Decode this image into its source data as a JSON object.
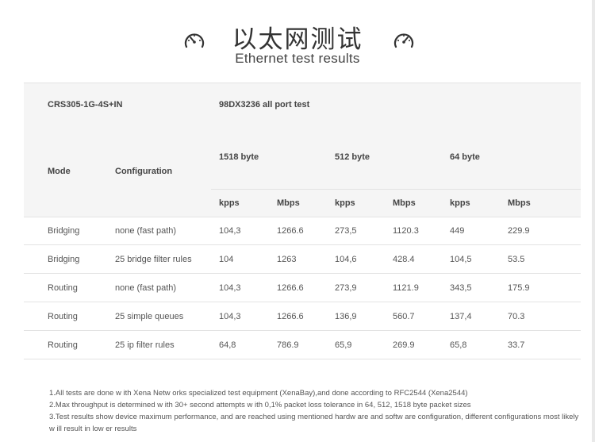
{
  "header": {
    "title_cn": "以太网测试",
    "title_en": "Ethernet test results",
    "left_icon": "speedometer-icon",
    "right_icon": "speedometer-icon"
  },
  "table": {
    "device": "CRS305-1G-4S+IN",
    "test_name": "98DX3236 all port test",
    "col_mode": "Mode",
    "col_config": "Configuration",
    "sizes": [
      "1518 byte",
      "512 byte",
      "64 byte"
    ],
    "unit_kpps": "kpps",
    "unit_mbps": "Mbps",
    "rows": [
      {
        "mode": "Bridging",
        "config": "none (fast path)",
        "v": [
          "104,3",
          "1266.6",
          "273,5",
          "1120.3",
          "449",
          "229.9"
        ]
      },
      {
        "mode": "Bridging",
        "config": "25 bridge filter rules",
        "v": [
          "104",
          "1263",
          "104,6",
          "428.4",
          "104,5",
          "53.5"
        ]
      },
      {
        "mode": "Routing",
        "config": "none (fast path)",
        "v": [
          "104,3",
          "1266.6",
          "273,9",
          "1121.9",
          "343,5",
          "175.9"
        ]
      },
      {
        "mode": "Routing",
        "config": "25 simple queues",
        "v": [
          "104,3",
          "1266.6",
          "136,9",
          "560.7",
          "137,4",
          "70.3"
        ]
      },
      {
        "mode": "Routing",
        "config": "25 ip filter rules",
        "v": [
          "64,8",
          "786.9",
          "65,9",
          "269.9",
          "65,8",
          "33.7"
        ]
      }
    ]
  },
  "notes": [
    "1.All tests are done w ith Xena Netw orks specialized test equipment (XenaBay),and done according to RFC2544 (Xena2544)",
    "2.Max throughput is determined w ith 30+ second attempts w ith 0,1% packet loss tolerance in 64, 512, 1518 byte packet sizes",
    "3.Test results show  device maximum performance, and are reached using mentioned hardw are and softw are configuration, different configurations most likely w ill result in low er results"
  ],
  "colors": {
    "border": "#e3e3e3",
    "header_bg": "#f5f5f5",
    "text": "#555555"
  }
}
